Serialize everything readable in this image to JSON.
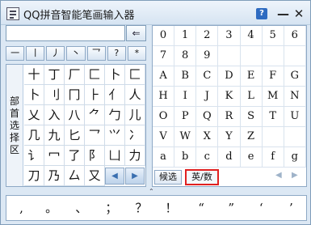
{
  "window": {
    "title": "QQ拼音智能笔画输入器",
    "help_label": "?",
    "minimize_label": "—",
    "close_label": "✕"
  },
  "input": {
    "value": "",
    "backspace_label": "⇐"
  },
  "strokes": [
    "一",
    "丨",
    "丿",
    "丶",
    "乛",
    "?",
    "*"
  ],
  "radical_label": [
    "部",
    "首",
    "选",
    "择",
    "区"
  ],
  "radicals": [
    "十",
    "丁",
    "厂",
    "匚",
    "卜",
    "匚",
    "卜",
    "刂",
    "冂",
    "⺊",
    "亻",
    "人",
    "乂",
    "入",
    "八",
    "⺈",
    "勹",
    "儿",
    "几",
    "九",
    "匕",
    "乛",
    "⺍",
    "冫",
    "讠",
    "冖",
    "了",
    "阝",
    "凵",
    "力",
    "刀",
    "乃",
    "厶",
    "又"
  ],
  "radical_nav": {
    "prev": "◀",
    "next": "▶"
  },
  "keys": [
    "0",
    "1",
    "2",
    "3",
    "4",
    "5",
    "6",
    "7",
    "8",
    "9",
    "",
    "",
    "",
    "",
    "A",
    "B",
    "C",
    "D",
    "E",
    "F",
    "G",
    "H",
    "I",
    "J",
    "K",
    "L",
    "M",
    "N",
    "O",
    "P",
    "Q",
    "R",
    "S",
    "T",
    "U",
    "V",
    "W",
    "X",
    "Y",
    "Z",
    "",
    "",
    "a",
    "b",
    "c",
    "d",
    "e",
    "f",
    "g"
  ],
  "key_bar": {
    "candidates_label": "候选",
    "mode_label": "英/数",
    "prev": "◀",
    "next": "▶"
  },
  "toggle_label": "⌃",
  "punctuation": [
    ",",
    "。",
    "、",
    "；",
    "？",
    "！",
    "“",
    "”",
    "‘",
    "’"
  ]
}
